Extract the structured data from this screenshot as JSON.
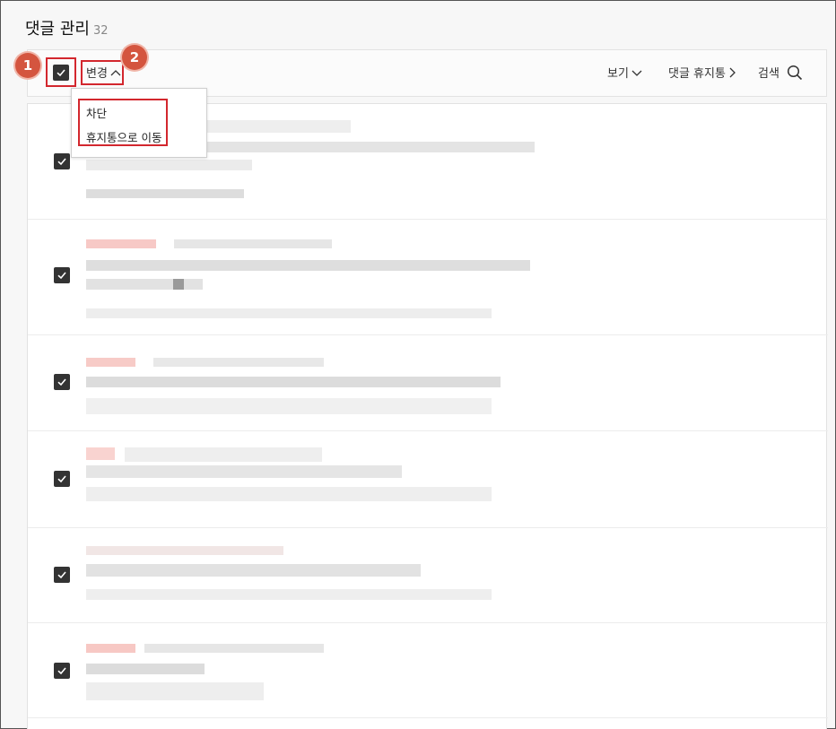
{
  "header": {
    "title": "댓글 관리",
    "count": "32"
  },
  "toolbar": {
    "change_label": "변경",
    "view_label": "보기",
    "trash_label": "댓글 휴지통",
    "search_label": "검색"
  },
  "dropdown": {
    "items": [
      "차단",
      "휴지통으로 이동"
    ]
  },
  "annotations": {
    "badge1": "1",
    "badge2": "2"
  },
  "colors": {
    "highlight": "#d3272e",
    "badge": "#d4553f",
    "checkbox": "#333333"
  },
  "comments": {
    "rows": 6,
    "all_checked": true
  }
}
